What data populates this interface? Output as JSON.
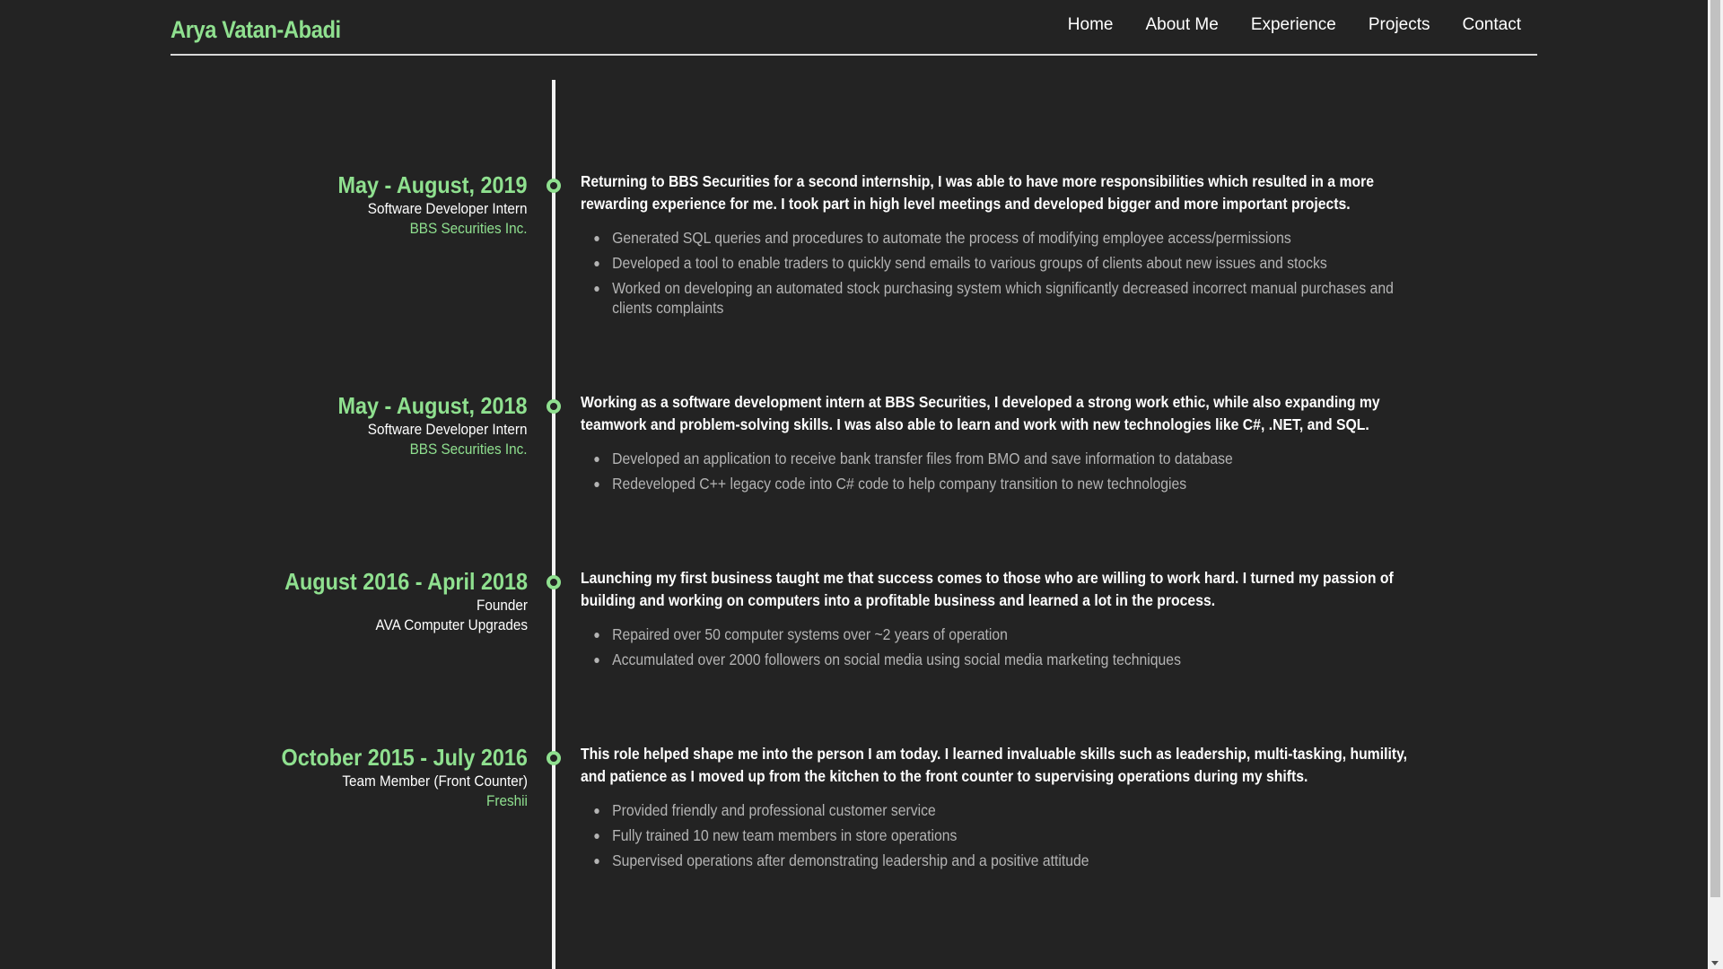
{
  "header": {
    "brand": "Arya Vatan-Abadi",
    "nav": [
      "Home",
      "About Me",
      "Experience",
      "Projects",
      "Contact"
    ]
  },
  "colors": {
    "background": "#232323",
    "accent": "#8fe08f",
    "text": "#ffffff",
    "muted": "#b4b4b4"
  },
  "experience": [
    {
      "date": "May - August, 2019",
      "role": "Software Developer Intern",
      "company": "BBS Securities Inc.",
      "summary": "Returning to BBS Securities for a second internship, I was able to have more responsibilities which resulted in a more rewarding experience for me. I took part in high level meetings and developed bigger and more important projects.",
      "bullets": [
        "Generated SQL queries and procedures to automate the process of modifying employee access/permissions",
        "Developed a tool to enable traders to quickly send emails to various groups of clients about new issues and stocks",
        "Worked on developing an automated stock purchasing system which significantly decreased incorrect manual purchases and clients complaints"
      ]
    },
    {
      "date": "May - August, 2018",
      "role": "Software Developer Intern",
      "company": "BBS Securities Inc.",
      "summary": "Working as a software development intern at BBS Securities, I developed a strong work ethic, while also expanding my teamwork and problem-solving skills. I was also able to learn and work with new technologies like C#, .NET, and SQL.",
      "bullets": [
        "Developed an application to receive bank transfer files from BMO and save information to database",
        "Redeveloped C++ legacy code into C# code to help company transition to new technologies"
      ]
    },
    {
      "date": "August 2016 - April 2018",
      "role": "Founder",
      "company": "AVA Computer Upgrades",
      "summary": "Launching my first business taught me that success comes to those who are willing to work hard. I turned my passion of building and working on computers into a profitable business and learned a lot in the process.",
      "bullets": [
        "Repaired over 50 computer systems over ~2 years of operation",
        "Accumulated over 2000 followers on social media using social media marketing techniques"
      ]
    },
    {
      "date": "October 2015 - July 2016",
      "role": "Team Member (Front Counter)",
      "company": "Freshii",
      "summary": "This role helped shape me into the person I am today. I learned invaluable skills such as leadership, multi-tasking, humility, and patience as I moved up from the kitchen to the front counter to supervising operations during my shifts.",
      "bullets": [
        "Provided friendly and professional customer service",
        "Fully trained 10 new team members in store operations",
        "Supervised operations after demonstrating leadership and a positive attitude"
      ]
    }
  ]
}
